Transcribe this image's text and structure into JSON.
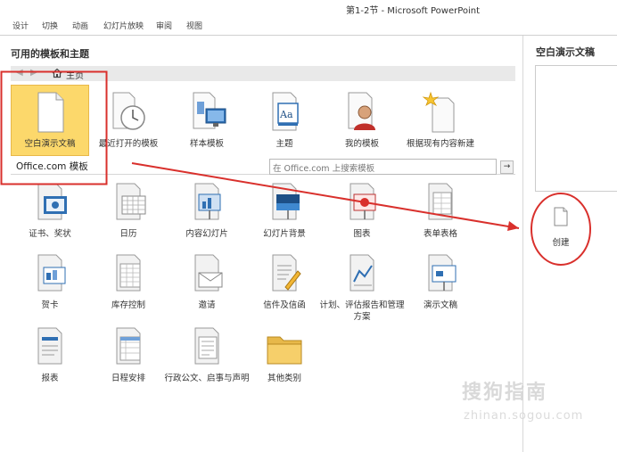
{
  "window": {
    "title": "第1-2节 - Microsoft PowerPoint"
  },
  "ribbon": {
    "tabs": [
      "设计",
      "切换",
      "动画",
      "幻灯片放映",
      "审阅",
      "视图"
    ]
  },
  "left": {
    "section_title": "可用的模板和主题",
    "nav": {
      "back": "◀",
      "forward": "▶",
      "home_label": "主页"
    },
    "top_templates": [
      {
        "label": "空白演示文稿",
        "icon": "blank-document-icon"
      },
      {
        "label": "最近打开的模板",
        "icon": "clock-document-icon"
      },
      {
        "label": "样本模板",
        "icon": "sample-template-icon"
      },
      {
        "label": "主题",
        "icon": "theme-icon"
      },
      {
        "label": "我的模板",
        "icon": "user-document-icon"
      },
      {
        "label": "根据现有内容新建",
        "icon": "new-from-existing-icon"
      }
    ],
    "officecom": {
      "label": "Office.com 模板",
      "search_placeholder": "在 Office.com 上搜索模板",
      "go": "→"
    },
    "officecom_templates": [
      {
        "label": "证书、奖状",
        "icon": "certificate-icon"
      },
      {
        "label": "日历",
        "icon": "calendar-icon"
      },
      {
        "label": "内容幻灯片",
        "icon": "content-slide-icon"
      },
      {
        "label": "幻灯片背景",
        "icon": "slide-background-icon"
      },
      {
        "label": "图表",
        "icon": "diagram-icon"
      },
      {
        "label": "表单表格",
        "icon": "form-icon"
      },
      {
        "label": "贺卡",
        "icon": "greeting-card-icon"
      },
      {
        "label": "库存控制",
        "icon": "inventory-icon"
      },
      {
        "label": "邀请",
        "icon": "invitation-icon"
      },
      {
        "label": "信件及信函",
        "icon": "letter-icon"
      },
      {
        "label": "计划、评估报告和管理方案",
        "icon": "plan-report-icon"
      },
      {
        "label": "演示文稿",
        "icon": "presentation-icon"
      },
      {
        "label": "报表",
        "icon": "report-icon"
      },
      {
        "label": "日程安排",
        "icon": "schedule-icon"
      },
      {
        "label": "行政公文、启事与声明",
        "icon": "official-document-icon"
      },
      {
        "label": "其他类别",
        "icon": "folder-icon"
      }
    ]
  },
  "right": {
    "preview_title": "空白演示文稿",
    "create_label": "创建"
  },
  "watermark": {
    "main": "搜狗指南",
    "sub": "zhinan.sogou.com"
  },
  "colors": {
    "selected": "#fcd86b",
    "annotation": "#d9302c",
    "accent": "#2f6fb3"
  }
}
